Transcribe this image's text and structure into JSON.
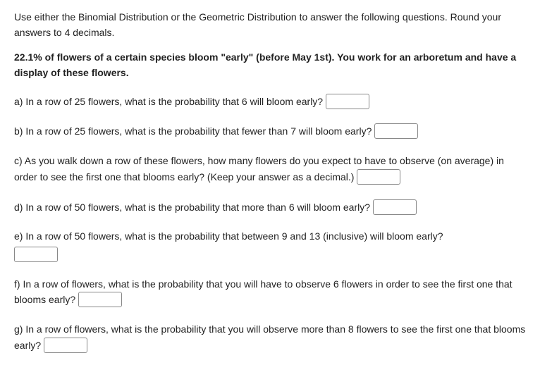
{
  "intro": "Use either the Binomial Distribution or the Geometric Distribution to answer the following questions. Round your answers to 4 decimals.",
  "scenario": "22.1% of flowers of a certain species bloom \"early\" (before May 1st). You work for an arboretum and have a display of these flowers.",
  "q": {
    "a": "a)  In a row of 25 flowers, what is the probability that 6 will bloom early? ",
    "b": "b)  In a row of 25 flowers, what is the probability that fewer than 7 will bloom early? ",
    "c_pre": "c)  As you walk down a row of these flowers, how many flowers do you expect to have to observe (on average) in order to see the first one that blooms early? (Keep your answer as a decimal.) ",
    "d": "d) In a row of 50 flowers, what is the probability that more than 6 will bloom early? ",
    "e": "e) In a row of 50 flowers, what is the probability that between 9 and 13 (inclusive) will bloom early?",
    "f_pre": "f) In a row of flowers, what is the probability that you will have to observe 6 flowers in order to see the first one that blooms early? ",
    "g_pre": "g) In a row of flowers, what is the probability that you will observe more than 8 flowers to see the first one that blooms early? "
  }
}
